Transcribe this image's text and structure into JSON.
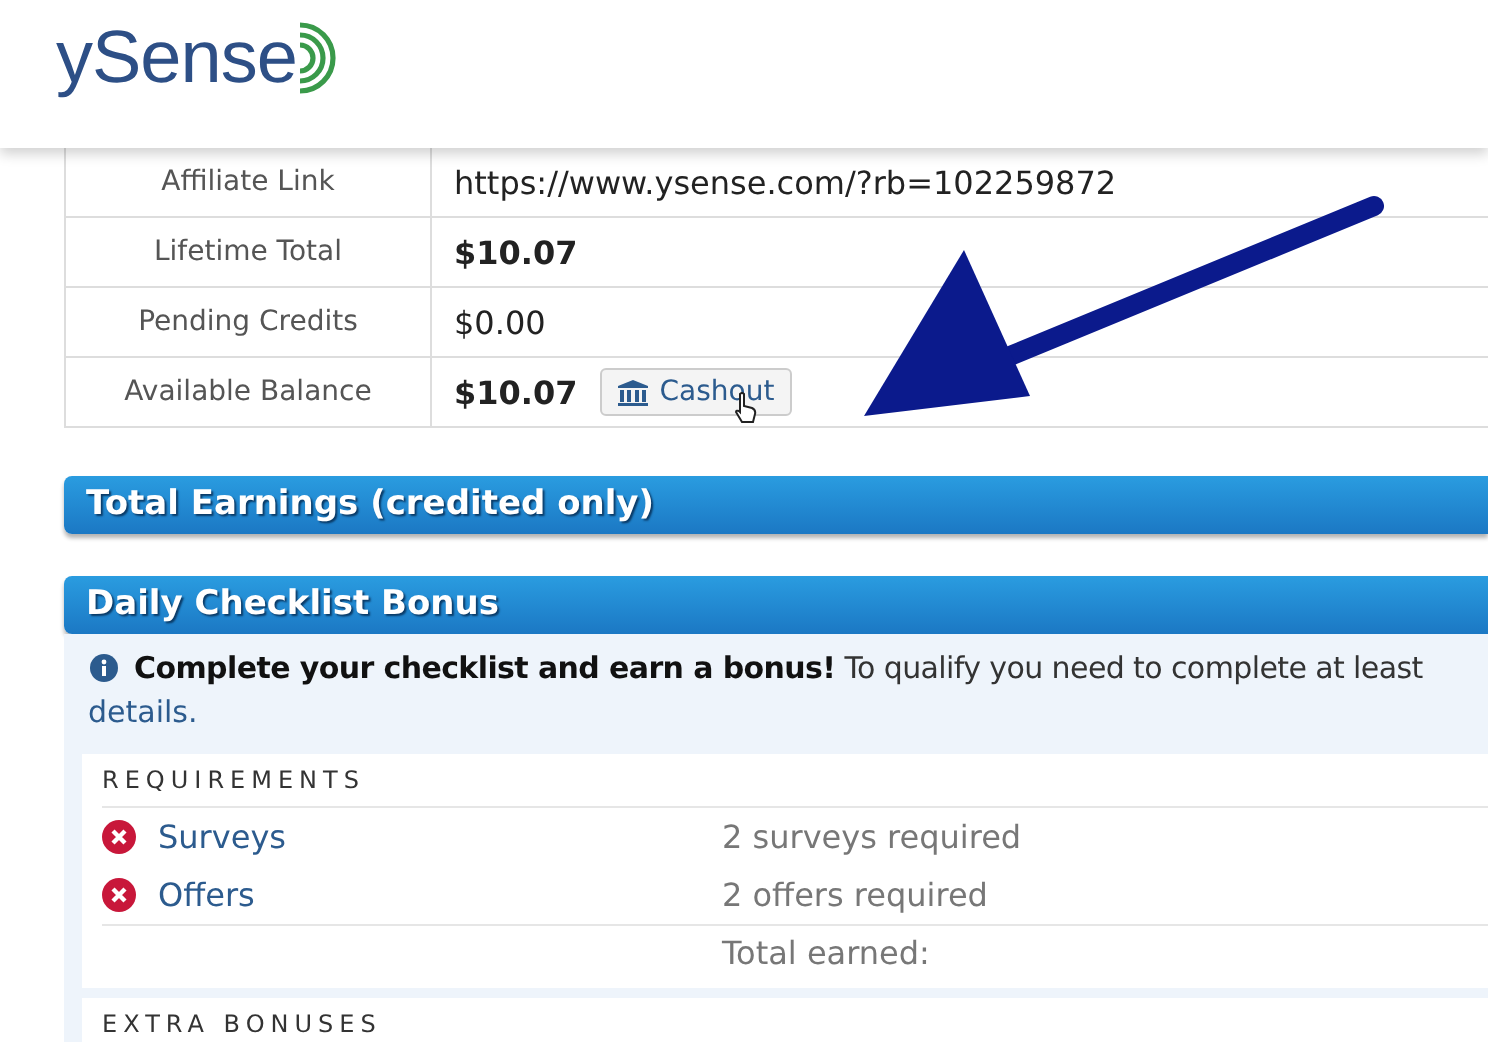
{
  "header": {
    "logo": "ySense"
  },
  "account_table": [
    {
      "label": "Affiliate Link",
      "value": "https://www.ysense.com/?rb=102259872",
      "bold": false
    },
    {
      "label": "Lifetime Total",
      "value": "$10.07",
      "bold": true
    },
    {
      "label": "Pending Credits",
      "value": "$0.00",
      "bold": false
    },
    {
      "label": "Available Balance",
      "value": "$10.07",
      "bold": true,
      "button": "Cashout"
    }
  ],
  "sections": [
    {
      "title": "Total Earnings (credited only)"
    },
    {
      "title": "Daily Checklist Bonus"
    }
  ],
  "checklist": {
    "info": "**Complete your checklist and earn a bonus!** To qualify you need to complete at least",
    "details_link": "details.",
    "requirements_heading": "REQUIREMENTS",
    "requirements": [
      {
        "name": "Surveys",
        "done": false,
        "note": "2 surveys required"
      },
      {
        "name": "Offers",
        "done": false,
        "note": "2 offers required"
      }
    ],
    "total_label": "Total earned:",
    "extra_heading": "EXTRA BONUSES"
  }
}
